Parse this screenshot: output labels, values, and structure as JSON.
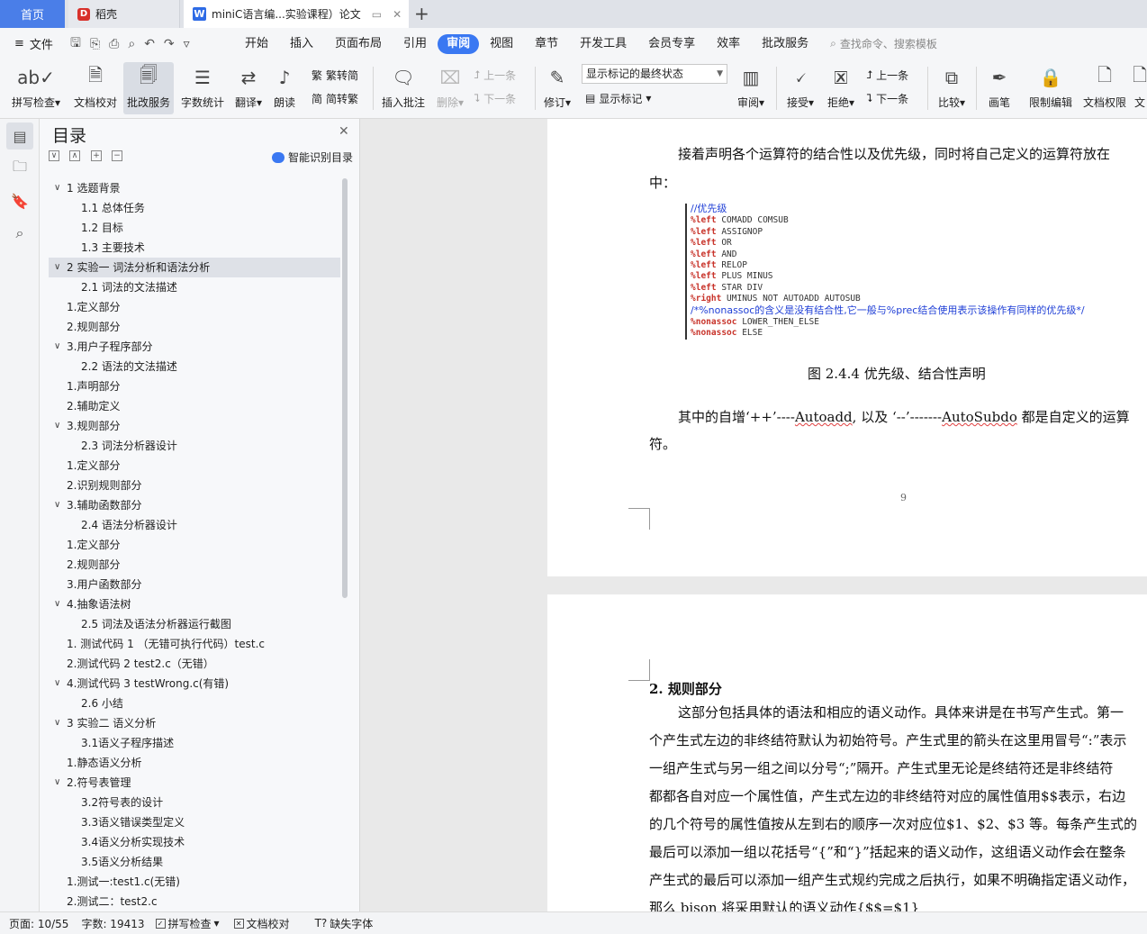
{
  "tabs": {
    "home": "首页",
    "docer": "稻壳",
    "document": "miniC语言编...实验课程）论文",
    "add": "+"
  },
  "menu": {
    "file": "文件",
    "items": [
      "开始",
      "插入",
      "页面布局",
      "引用",
      "审阅",
      "视图",
      "章节",
      "开发工具",
      "会员专享",
      "效率",
      "批改服务"
    ],
    "active": "审阅",
    "search": "查找命令、搜索模板"
  },
  "ribbon": {
    "spell_check": "拼写检查",
    "doc_proof": "文档校对",
    "correction_service": "批改服务",
    "word_count": "字数统计",
    "translate": "翻译",
    "read_aloud": "朗读",
    "trad_to_simp": "繁转简",
    "simp_to_trad": "简转繁",
    "insert_comment": "插入批注",
    "delete": "删除",
    "prev": "上一条",
    "next": "下一条",
    "revise": "修订",
    "markup_state": "显示标记的最终状态",
    "show_markup": "显示标记",
    "review": "审阅",
    "accept": "接受",
    "reject": "拒绝",
    "prev2": "上一条",
    "next2": "下一条",
    "compare": "比较",
    "pen": "画笔",
    "restrict_edit": "限制编辑",
    "doc_permission": "文档权限",
    "more": "文"
  },
  "toc": {
    "title": "目录",
    "smart": "智能识别目录",
    "items": [
      {
        "text": "1  选题背景",
        "level": 1,
        "chev": true
      },
      {
        "text": "1.1  总体任务",
        "level": 2
      },
      {
        "text": "1.2  目标",
        "level": 2
      },
      {
        "text": "1.3  主要技术",
        "level": 2
      },
      {
        "text": "2  实验一  词法分析和语法分析",
        "level": 1,
        "chev": true,
        "selected": true
      },
      {
        "text": "2.1  词法的文法描述",
        "level": 2
      },
      {
        "text": "1.定义部分",
        "level": 1
      },
      {
        "text": "2.规则部分",
        "level": 1
      },
      {
        "text": "3.用户子程序部分",
        "level": 1,
        "chev": true
      },
      {
        "text": "2.2  语法的文法描述",
        "level": 2
      },
      {
        "text": "1.声明部分",
        "level": 1
      },
      {
        "text": "2.辅助定义",
        "level": 1
      },
      {
        "text": "3.规则部分",
        "level": 1,
        "chev": true
      },
      {
        "text": "2.3  词法分析器设计",
        "level": 2
      },
      {
        "text": "1.定义部分",
        "level": 1
      },
      {
        "text": "2.识别规则部分",
        "level": 1
      },
      {
        "text": "3.辅助函数部分",
        "level": 1,
        "chev": true
      },
      {
        "text": "2.4  语法分析器设计",
        "level": 2
      },
      {
        "text": "1.定义部分",
        "level": 1
      },
      {
        "text": "2.规则部分",
        "level": 1
      },
      {
        "text": "3.用户函数部分",
        "level": 1
      },
      {
        "text": "4.抽象语法树",
        "level": 1,
        "chev": true
      },
      {
        "text": "2.5  词法及语法分析器运行截图",
        "level": 2
      },
      {
        "text": "1.  测试代码 1  （无错可执行代码）test.c",
        "level": 1
      },
      {
        "text": "2.测试代码 2    test2.c（无错）",
        "level": 1
      },
      {
        "text": "4.测试代码 3    testWrong.c(有错)",
        "level": 1,
        "chev": true
      },
      {
        "text": "2.6  小结",
        "level": 2
      },
      {
        "text": "3  实验二  语义分析",
        "level": 1,
        "chev": true
      },
      {
        "text": "3.1语义子程序描述",
        "level": 2
      },
      {
        "text": "1.静态语义分析",
        "level": 1
      },
      {
        "text": "2.符号表管理",
        "level": 1,
        "chev": true
      },
      {
        "text": "3.2符号表的设计",
        "level": 2
      },
      {
        "text": "3.3语义错误类型定义",
        "level": 2
      },
      {
        "text": "3.4语义分析实现技术",
        "level": 2
      },
      {
        "text": "3.5语义分析结果",
        "level": 2
      },
      {
        "text": "1.测试一:test1.c(无错)",
        "level": 1
      },
      {
        "text": "2.测试二：test2.c",
        "level": 1
      }
    ]
  },
  "doc": {
    "p1_line1": "接着声明各个运算符的结合性以及优先级，同时将自己定义的运算符放在",
    "p1_line2": "中：",
    "code": [
      {
        "kind": "comment",
        "text": "//优先级"
      },
      {
        "kind": "kw",
        "kw": "%left",
        "rest": " COMADD COMSUB"
      },
      {
        "kind": "kw",
        "kw": "%left",
        "rest": " ASSIGNOP"
      },
      {
        "kind": "kw",
        "kw": "%left",
        "rest": " OR"
      },
      {
        "kind": "kw",
        "kw": "%left",
        "rest": " AND"
      },
      {
        "kind": "kw",
        "kw": "%left",
        "rest": " RELOP"
      },
      {
        "kind": "kw",
        "kw": "%left",
        "rest": " PLUS MINUS"
      },
      {
        "kind": "kw",
        "kw": "%left",
        "rest": " STAR DIV"
      },
      {
        "kind": "kw",
        "kw": "%right",
        "rest": " UMINUS NOT AUTOADD AUTOSUB"
      },
      {
        "kind": "comment",
        "text": "/*%nonassoc的含义是没有结合性,它一般与%prec结合使用表示该操作有同样的优先级*/"
      },
      {
        "kind": "kw",
        "kw": "%nonassoc",
        "rest": " LOWER_THEN_ELSE"
      },
      {
        "kind": "kw",
        "kw": "%nonassoc",
        "rest": " ELSE"
      }
    ],
    "caption": "图 2.4.4    优先级、结合性声明",
    "p2_line1_a": "其中的自增‘++’----",
    "p2_autoadd": "Autoadd",
    "p2_line1_b": ", 以及 ‘--’-------",
    "p2_autosubdo": "AutoSubdo",
    "p2_line1_c": " 都是自定义的运算",
    "p2_line2": "符。",
    "page_number": "9",
    "heading": "2.   规则部分",
    "body": [
      "这部分包括具体的语法和相应的语义动作。具体来讲是在书写产生式。第一",
      "个产生式左边的非终结符默认为初始符号。产生式里的箭头在这里用冒号“:”表示",
      "一组产生式与另一组之间以分号“;”隔开。产生式里无论是终结符还是非终结符",
      "都都各自对应一个属性值，产生式左边的非终结符对应的属性值用$$表示，右边",
      "的几个符号的属性值按从左到右的顺序一次对应位$1、$2、$3 等。每条产生式的",
      "最后可以添加一组以花括号“{”和“}”括起来的语义动作，这组语义动作会在整条",
      "产生式的最后可以添加一组产生式规约完成之后执行，如果不明确指定语义动作，",
      "那么 bison 将采用默认的语义动作{$$=$1}"
    ]
  },
  "status": {
    "page": "页面: 10/55",
    "words": "字数: 19413",
    "spell": "拼写检查",
    "proof": "文档校对",
    "missing_font": "缺失字体"
  }
}
